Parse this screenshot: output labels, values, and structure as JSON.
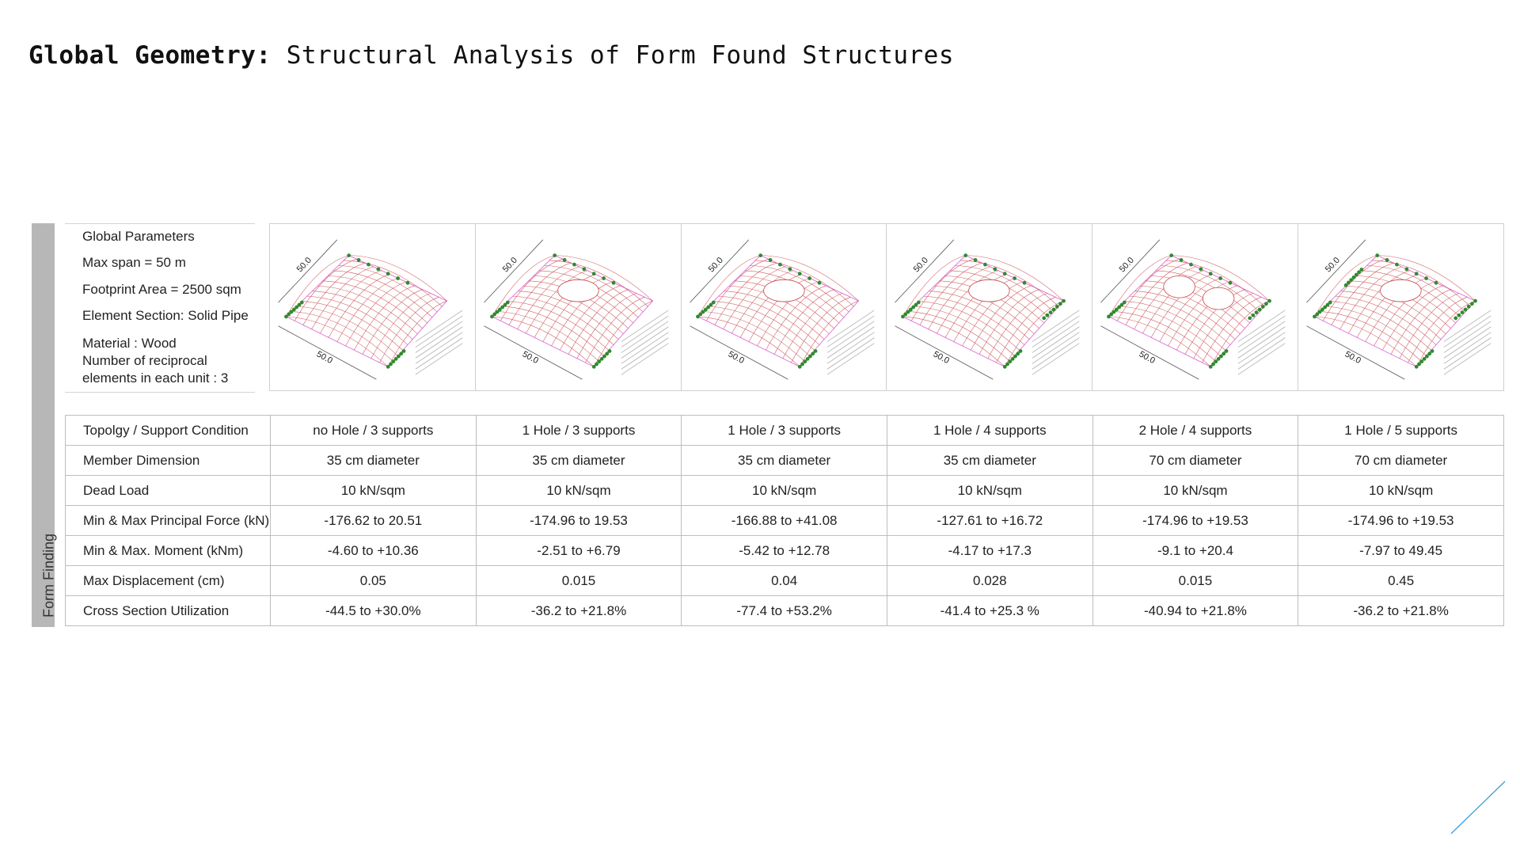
{
  "header": {
    "title_bold": "Global Geometry:",
    "title_rest": " Structural Analysis of Form Found Structures"
  },
  "side_label": "Form Finding",
  "global_parameters": [
    "Global Parameters",
    "Max span = 50 m",
    "Footprint Area = 2500 sqm",
    "Element Section: Solid Pipe",
    "Material : Wood",
    "Number of reciprocal",
    "elements in each unit : 3"
  ],
  "diagrams": [
    {
      "name": "no-hole-3-supports",
      "dim_a": "50.0",
      "dim_b": "50.0",
      "holes": 0,
      "supports": 3
    },
    {
      "name": "1-hole-3-supports",
      "dim_a": "50.0",
      "dim_b": "50.0",
      "holes": 1,
      "supports": 3
    },
    {
      "name": "1-hole-3-supports-b",
      "dim_a": "50.0",
      "dim_b": "50.0",
      "holes": 1,
      "supports": 3
    },
    {
      "name": "1-hole-4-supports",
      "dim_a": "50.0",
      "dim_b": "50.0",
      "holes": 1,
      "supports": 4
    },
    {
      "name": "2-hole-4-supports",
      "dim_a": "50.0",
      "dim_b": "50.0",
      "holes": 2,
      "supports": 4
    },
    {
      "name": "1-hole-5-supports",
      "dim_a": "50.0",
      "dim_b": "50.0",
      "dim_c": "50.0",
      "dim_d": "50.0",
      "holes": 1,
      "supports": 5
    }
  ],
  "colors": {
    "mesh": "#c8444a",
    "support": "#2e8b2e",
    "boundary": "#e07ae0",
    "dimension": "#555555",
    "side_bar": "#b7b7b8",
    "accent": "#3aa0d8"
  },
  "table": {
    "rows": [
      {
        "label": "Topolgy / Support Condition",
        "values": [
          "no Hole / 3 supports",
          "1 Hole / 3 supports",
          "1 Hole / 3 supports",
          "1 Hole / 4 supports",
          "2 Hole / 4 supports",
          "1 Hole / 5 supports"
        ]
      },
      {
        "label": "Member Dimension",
        "values": [
          "35 cm diameter",
          "35 cm diameter",
          "35 cm diameter",
          "35 cm diameter",
          "70 cm diameter",
          "70 cm diameter"
        ]
      },
      {
        "label": "Dead Load",
        "values": [
          "10 kN/sqm",
          "10 kN/sqm",
          "10 kN/sqm",
          "10 kN/sqm",
          "10 kN/sqm",
          "10 kN/sqm"
        ]
      },
      {
        "label": "Min & Max Principal Force (kN)",
        "values": [
          "-176.62 to 20.51",
          "-174.96 to 19.53",
          "-166.88 to +41.08",
          "-127.61 to +16.72",
          "-174.96  to +19.53",
          "-174.96 to +19.53"
        ]
      },
      {
        "label": "Min & Max. Moment (kNm)",
        "values": [
          "-4.60 to +10.36",
          "-2.51 to +6.79",
          "-5.42  to +12.78",
          "-4.17  to +17.3",
          "-9.1 to +20.4",
          "-7.97 to 49.45"
        ]
      },
      {
        "label": "Max Displacement (cm)",
        "values": [
          "0.05",
          "0.015",
          "0.04",
          "0.028",
          "0.015",
          "0.45"
        ]
      },
      {
        "label": "Cross Section Utilization",
        "values": [
          "-44.5  to  +30.0%",
          "-36.2 to +21.8%",
          "-77.4  to +53.2%",
          "-41.4  to +25.3 %",
          "-40.94 to  +21.8%",
          "-36.2  to +21.8%"
        ]
      }
    ]
  }
}
